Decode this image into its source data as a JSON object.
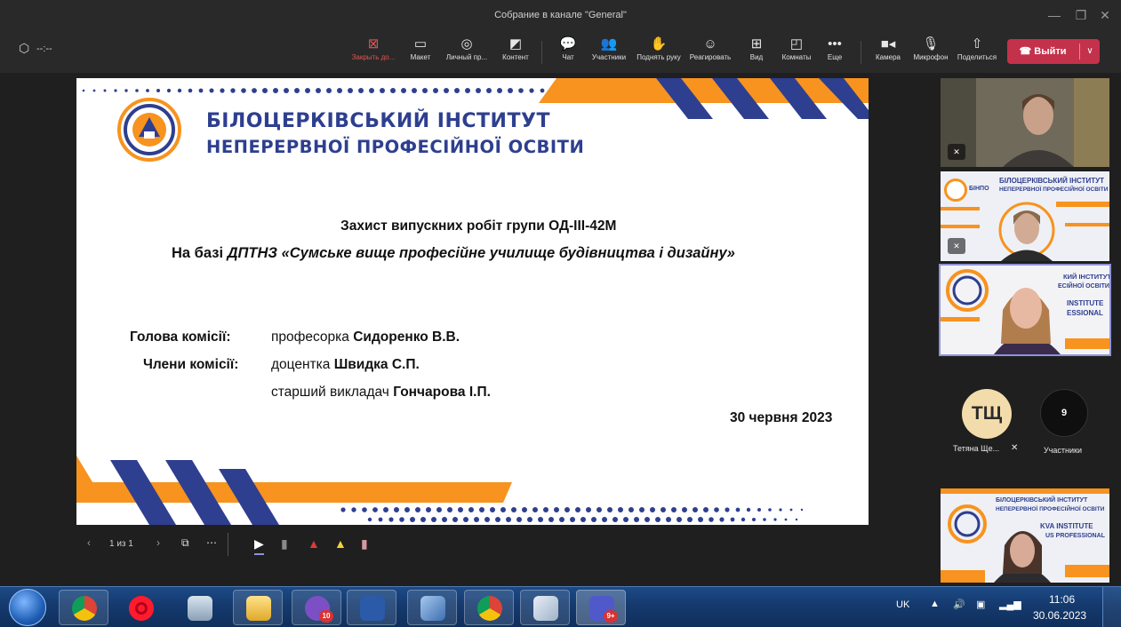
{
  "window": {
    "title": "Собрание в канале \"General\""
  },
  "window_controls": {
    "minimize": "—",
    "maximize": "❐",
    "close": "✕"
  },
  "meeting": {
    "timer": "--:--"
  },
  "toolbar": {
    "stop_share": "Закрыть до...",
    "layout": "Макет",
    "personal": "Личный пр...",
    "content": "Контент",
    "chat": "Чат",
    "participants": "Участники",
    "raise_hand": "Поднять руку",
    "react": "Реагировать",
    "view": "Вид",
    "rooms": "Комнаты",
    "more": "Еще",
    "camera": "Камера",
    "mic": "Микрофон",
    "share": "Поделиться",
    "leave": "Выйти"
  },
  "slide": {
    "institute_line1": "БІЛОЦЕРКІВСЬКИЙ ІНСТИТУТ",
    "institute_line2": "НЕПЕРЕРВНОЇ ПРОФЕСІЙНОЇ ОСВІТИ",
    "subtitle1": "Захист випускних робіт групи ОД-ІІІ-42М",
    "subtitle2_prefix": "На базі ",
    "subtitle2_italic": "ДПТНЗ «Сумське вище професійне училище будівництва і дизайну»",
    "chair_label": "Голова комісії:",
    "chair_role": "професорка ",
    "chair_name": "Сидоренко В.В.",
    "members_label": "Члени комісії:",
    "member1_role": "доцентка ",
    "member1_name": "Швидка С.П.",
    "member2_role": "старший викладач ",
    "member2_name": "Гончарова І.П.",
    "date": "30 червня 2023"
  },
  "slide_controls": {
    "pager": "1 из 1"
  },
  "participants": {
    "avatar_initials": "ТЩ",
    "avatar_name": "Тетяна Ще...",
    "count": "9",
    "count_label": "Участники",
    "tile2_slide_line1": "БІЛОЦЕРКІВСЬКИЙ ІНСТИТУТ",
    "tile2_slide_line2": "НЕПЕРЕРВНОЇ ПРОФЕСІЙНОЇ ОСВІТИ",
    "tile2_abbr": "БІНПО",
    "tile3_line1": "КИЙ ІНСТИТУТ",
    "tile3_line2": "ЕСІЙНОЇ ОСВІТИ",
    "tile3_line3": "INSTITUTE",
    "tile3_line4": "ESSIONAL",
    "tile4_line1": "БІЛОЦЕРКІВСЬКИЙ ІНСТИТУТ",
    "tile4_line2": "НЕПЕРЕРВНОЇ ПРОФЕСІЙНОЇ ОСВІТИ",
    "tile4_line3": "KVA INSTITUTE",
    "tile4_line4": "US PROFESSIONAL"
  },
  "taskbar": {
    "viber_badge": "10",
    "teams_badge": "9+",
    "lang": "UK",
    "time": "11:06",
    "date": "30.06.2023"
  },
  "colors": {
    "accent_blue": "#2e3f8f",
    "accent_orange": "#f7931e",
    "leave_red": "#c4314b"
  }
}
